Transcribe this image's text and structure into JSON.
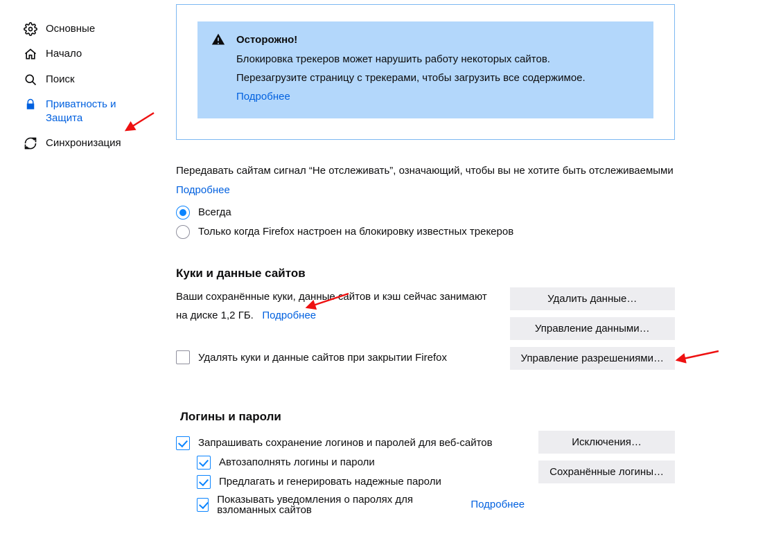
{
  "sidebar": {
    "items": [
      {
        "label": "Основные"
      },
      {
        "label": "Начало"
      },
      {
        "label": "Поиск"
      },
      {
        "label": "Приватность и Защита"
      },
      {
        "label": "Синхронизация"
      }
    ]
  },
  "alert": {
    "heading": "Осторожно!",
    "line1": "Блокировка трекеров может нарушить работу некоторых сайтов.",
    "line2": "Перезагрузите страницу с трекерами, чтобы загрузить все содержимое.",
    "learn_more": "Подробнее"
  },
  "dnt": {
    "description": "Передавать сайтам сигнал “Не отслеживать”, означающий, чтобы вы не хотите быть отслеживаемыми",
    "learn_more": "Подробнее",
    "option_always": "Всегда",
    "option_only_blocking": "Только когда Firefox настроен на блокировку известных трекеров"
  },
  "cookies": {
    "heading": "Куки и данные сайтов",
    "usage_prefix": "Ваши сохранённые куки, данные сайтов и кэш сейчас занимают на диске ",
    "usage_size": "1,2 ГБ.",
    "learn_more": "Подробнее",
    "btn_clear": "Удалить данные…",
    "btn_manage": "Управление данными…",
    "btn_permissions": "Управление разрешениями…",
    "check_delete_on_close": "Удалять куки и данные сайтов при закрытии Firefox"
  },
  "logins": {
    "heading": "Логины и пароли",
    "check_ask_save": "Запрашивать сохранение логинов и паролей для веб-сайтов",
    "check_autofill": "Автозаполнять логины и пароли",
    "check_generate": "Предлагать и генерировать надежные пароли",
    "check_breach": "Показывать уведомления о паролях для взломанных сайтов",
    "breach_learn_more": "Подробнее",
    "btn_exceptions": "Исключения…",
    "btn_saved": "Сохранённые логины…"
  }
}
